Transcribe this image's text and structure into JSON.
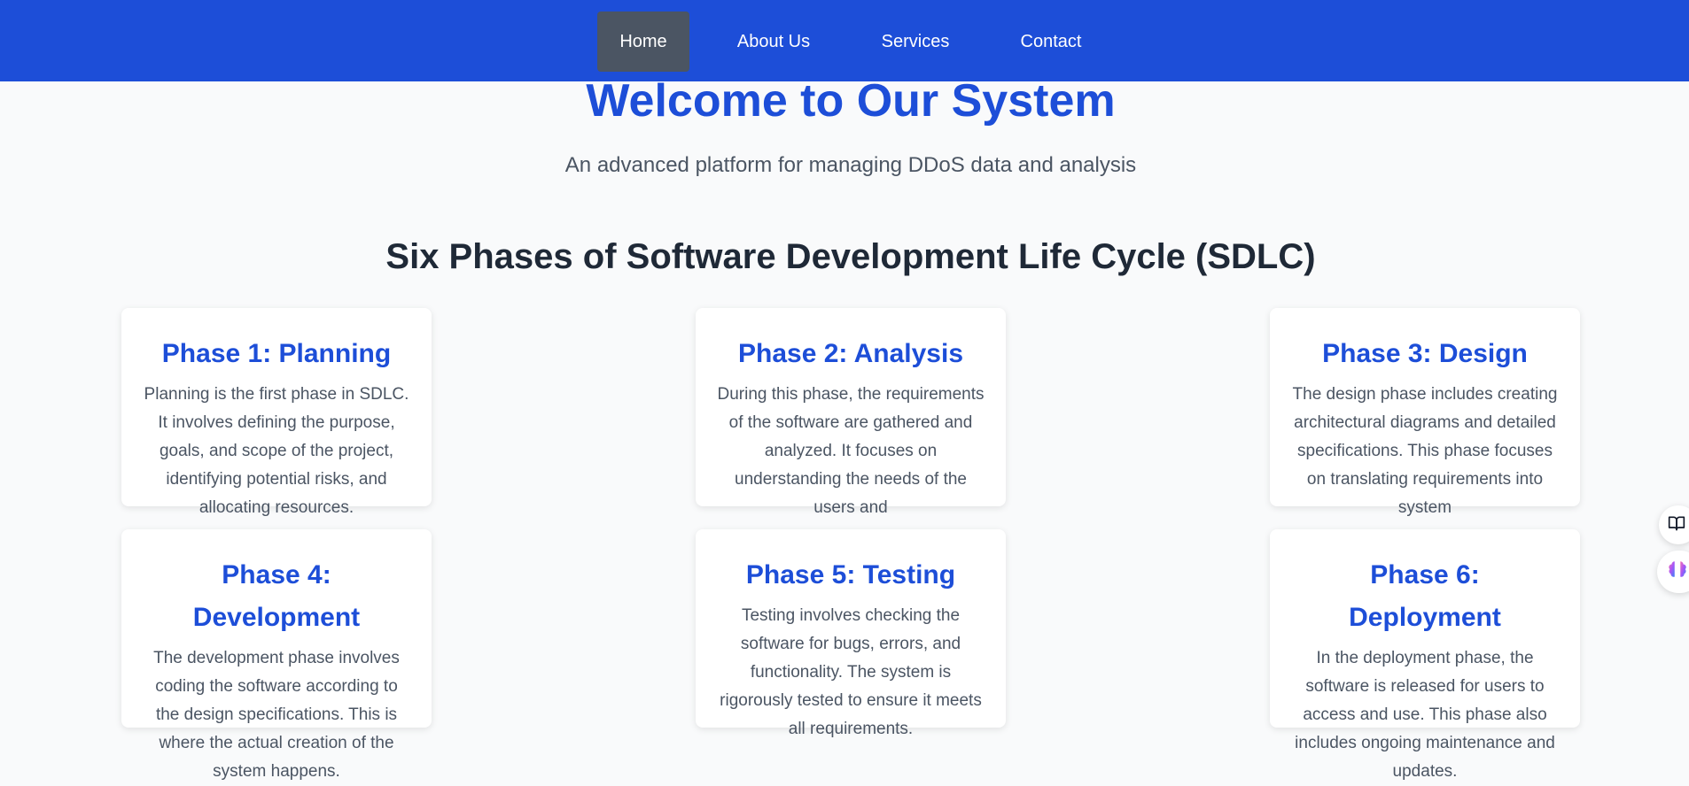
{
  "nav": {
    "items": [
      {
        "label": "Home",
        "active": true
      },
      {
        "label": "About Us",
        "active": false
      },
      {
        "label": "Services",
        "active": false
      },
      {
        "label": "Contact",
        "active": false
      }
    ]
  },
  "hero": {
    "title": "Welcome to Our System",
    "subtitle": "An advanced platform for managing DDoS data and analysis"
  },
  "section": {
    "title": "Six Phases of Software Development Life Cycle (SDLC)"
  },
  "phases": [
    {
      "title": "Phase 1: Planning",
      "text": "Planning is the first phase in SDLC. It involves defining the purpose, goals, and scope of the project, identifying potential risks, and allocating resources."
    },
    {
      "title": "Phase 2: Analysis",
      "text": "During this phase, the requirements of the software are gathered and analyzed. It focuses on understanding the needs of the users and"
    },
    {
      "title": "Phase 3: Design",
      "text": "The design phase includes creating architectural diagrams and detailed specifications. This phase focuses on translating requirements into system"
    },
    {
      "title": "Phase 4: Development",
      "text": "The development phase involves coding the software according to the design specifications. This is where the actual creation of the system happens."
    },
    {
      "title": "Phase 5: Testing",
      "text": "Testing involves checking the software for bugs, errors, and functionality. The system is rigorously tested to ensure it meets all requirements."
    },
    {
      "title": "Phase 6: Deployment",
      "text": "In the deployment phase, the software is released for users to access and use. This phase also includes ongoing maintenance and updates."
    }
  ],
  "side_buttons": [
    {
      "icon": "book-icon"
    },
    {
      "icon": "brain-icon"
    }
  ],
  "colors": {
    "nav_bg": "#1d4ed8",
    "accent": "#1d4ed8",
    "active_nav": "#4b5563",
    "heading": "#1f2937",
    "body_text": "#4b5563",
    "page_bg": "#f9fafb"
  }
}
